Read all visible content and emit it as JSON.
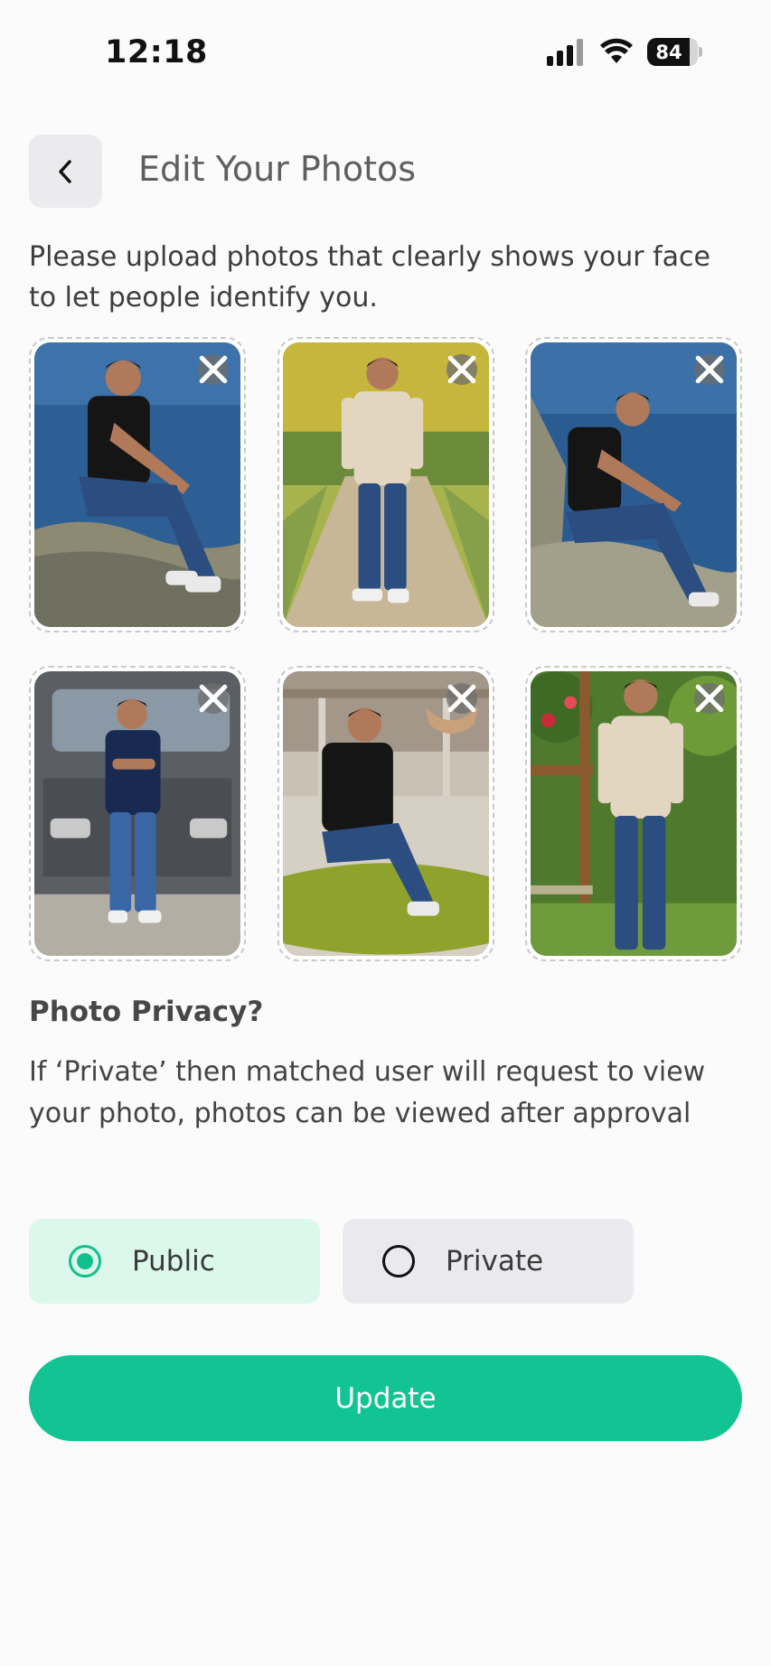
{
  "status_bar": {
    "time": "12:18",
    "battery_percent": "84",
    "battery_level": 0.84
  },
  "header": {
    "back_icon": "chevron-left-icon",
    "title": "Edit Your Photos"
  },
  "instructions": "Please upload photos that clearly shows your face to let people identify you.",
  "photos": [
    {
      "scene": "man in black t-shirt sitting on rock by sea",
      "remove_icon": "close-icon"
    },
    {
      "scene": "man in beige shirt standing on leafy park path",
      "remove_icon": "close-icon"
    },
    {
      "scene": "man in black t-shirt sitting on rocks by sea",
      "remove_icon": "close-icon"
    },
    {
      "scene": "man in navy polo standing in front of truck",
      "remove_icon": "close-icon"
    },
    {
      "scene": "man in black polo sitting on green ottoman in mall",
      "remove_icon": "close-icon"
    },
    {
      "scene": "man in beige shirt standing in garden",
      "remove_icon": "close-icon"
    }
  ],
  "privacy": {
    "heading": "Photo Privacy?",
    "description": "If ‘Private’ then matched user will request to view your photo, photos can be viewed after approval",
    "options": [
      {
        "label": "Public",
        "selected": true
      },
      {
        "label": "Private",
        "selected": false
      }
    ]
  },
  "update_label": "Update",
  "colors": {
    "accent": "#12c493",
    "public_bg": "#dcf8ec",
    "private_bg": "#eaeaee"
  }
}
